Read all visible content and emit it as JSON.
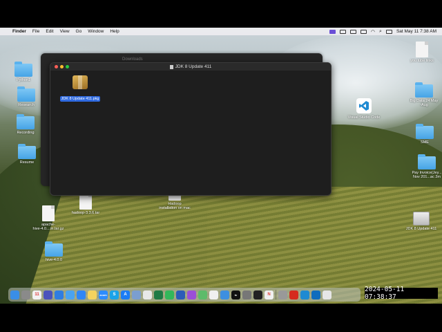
{
  "menubar": {
    "apple": "",
    "items": [
      "Finder",
      "File",
      "Edit",
      "View",
      "Go",
      "Window",
      "Help"
    ],
    "clock": "Sat May 11  7:38 AM"
  },
  "desktop_icons": [
    {
      "label": "Python1",
      "icon": "folder-icon"
    },
    {
      "label": "Research",
      "icon": "folder-icon"
    },
    {
      "label": "Recording",
      "icon": "folder-icon"
    },
    {
      "label": "Resume",
      "icon": "folder-icon"
    },
    {
      "label": "hadoop-3.3.6.tar",
      "icon": "archive-icon"
    },
    {
      "label": "Hadoop\ninstallation on mac",
      "icon": "document-icon"
    },
    {
      "label": "apache-\nhive-4.0....in.tar.gz",
      "icon": "archive-icon"
    },
    {
      "label": "hive-4.0.0",
      "icon": "folder-icon"
    },
    {
      "label": "you tube links",
      "icon": "document-icon"
    },
    {
      "label": "Big Data 24 May\n-Aug",
      "icon": "folder-icon"
    },
    {
      "label": "Visual Studio Code",
      "icon": "vscode-icon"
    },
    {
      "label": "SME",
      "icon": "folder-icon"
    },
    {
      "label": "Pay Invoice(Jey...\nNov 201...ac 2m",
      "icon": "folder-icon"
    },
    {
      "label": "JDK 8 Update 411",
      "icon": "disk-icon"
    }
  ],
  "bg_window": {
    "title": "Downloads"
  },
  "finder_window": {
    "title": "JDK 8 Update 411",
    "file": {
      "label": "JDK 8 Update 411.pkg"
    }
  },
  "dock": {
    "apps": [
      "Finder",
      "Launchpad",
      "Calendar",
      "Teams",
      "Files",
      "Mail",
      "Safari",
      "Notes",
      "Zoom",
      "Skype",
      "App Store",
      "Preview",
      "Chrome",
      "Excel",
      "Numbers",
      "Word",
      "Podcasts",
      "Maps",
      "Photos",
      "Weather",
      "Apple TV",
      "Settings",
      "Terminal",
      "News",
      "Preferences",
      "Acrobat",
      "VS Code",
      "Outlook",
      "Finder Window"
    ]
  },
  "timestamp": "2024-05-11  07:38:37"
}
